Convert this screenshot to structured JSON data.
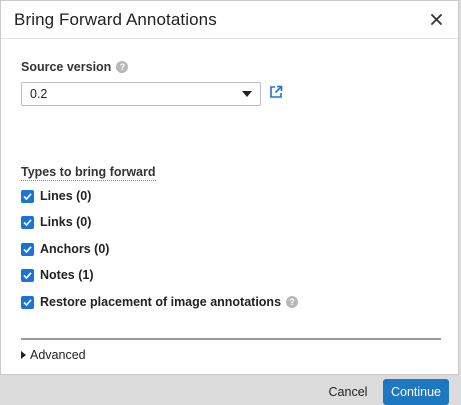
{
  "dialog": {
    "title": "Bring Forward Annotations",
    "close_icon": "close-icon"
  },
  "source": {
    "label": "Source version",
    "help_icon": "question-circle-icon",
    "selected_value": "0.2",
    "link_icon": "external-link-icon"
  },
  "types": {
    "label": "Types to bring forward",
    "options": [
      {
        "label": "Lines (0)",
        "checked": true
      },
      {
        "label": "Links (0)",
        "checked": true
      },
      {
        "label": "Anchors (0)",
        "checked": true
      },
      {
        "label": "Notes (1)",
        "checked": true
      }
    ],
    "restore": {
      "label": "Restore placement of image annotations",
      "checked": true
    }
  },
  "advanced": {
    "label": "Advanced"
  },
  "buttons": {
    "cancel": "Cancel",
    "continue": "Continue"
  },
  "colors": {
    "accent": "#1d78c1",
    "checkbox": "#1a73d9"
  }
}
